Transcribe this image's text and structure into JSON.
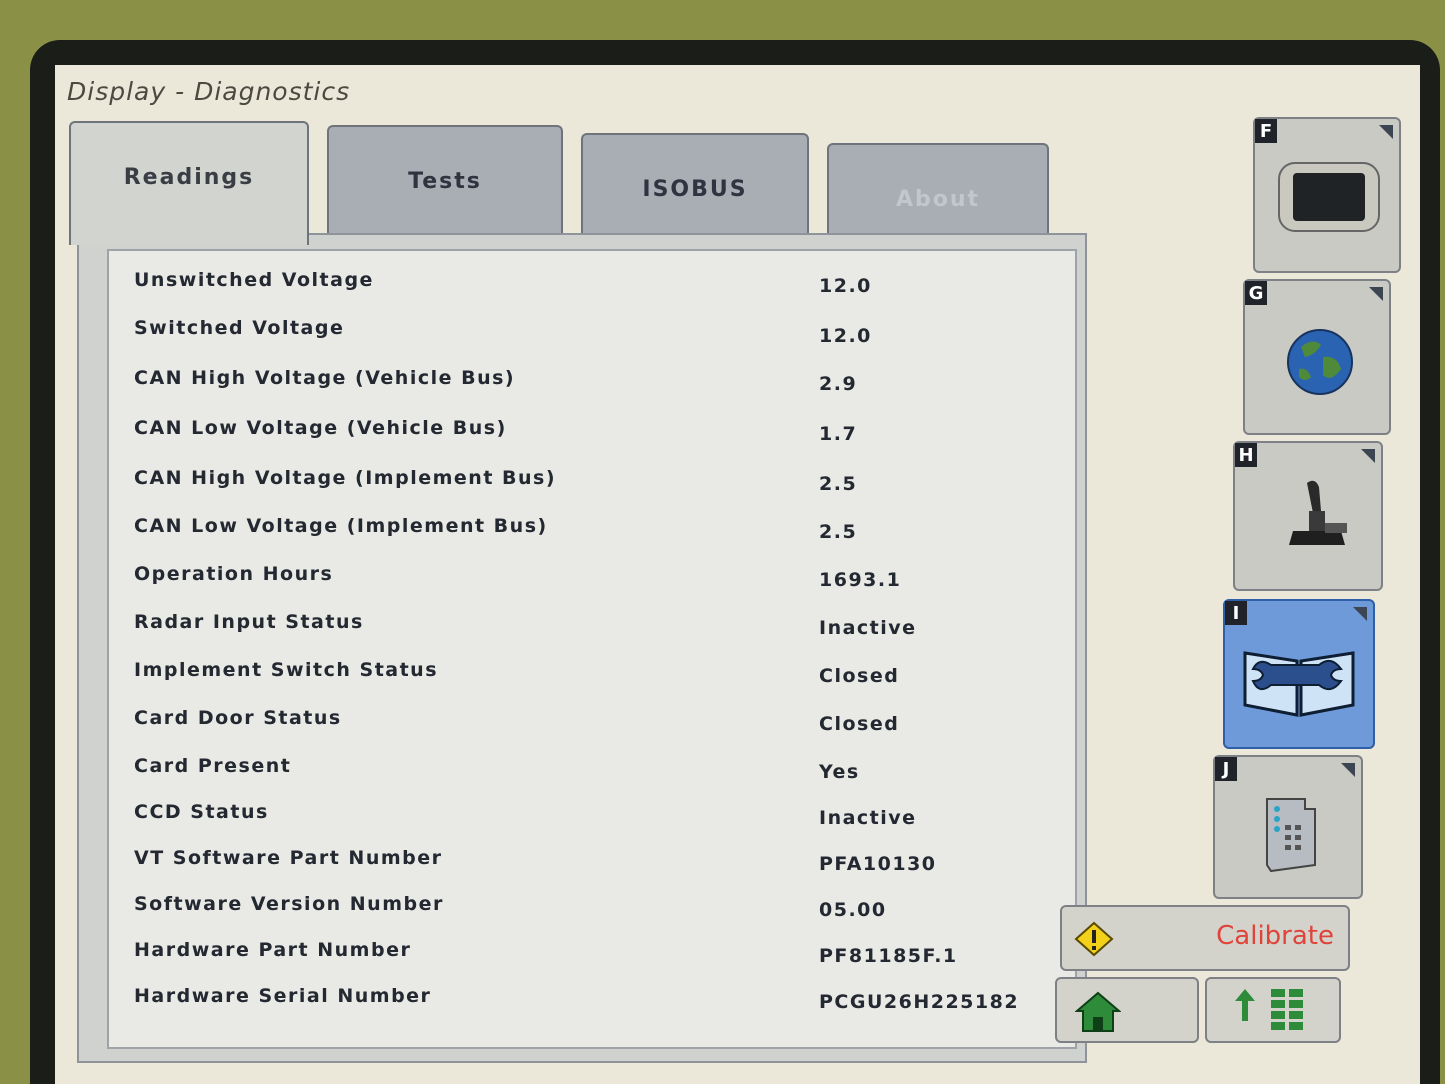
{
  "window": {
    "title": "Display - Diagnostics"
  },
  "tabs": [
    {
      "label": "Readings",
      "active": true
    },
    {
      "label": "Tests"
    },
    {
      "label": "ISOBUS"
    },
    {
      "label": "About",
      "disabled": true
    }
  ],
  "readings": [
    {
      "label": "Unswitched Voltage",
      "value": "12.0"
    },
    {
      "label": "Switched Voltage",
      "value": "12.0"
    },
    {
      "label": "CAN High Voltage (Vehicle Bus)",
      "value": "2.9"
    },
    {
      "label": "CAN Low Voltage (Vehicle Bus)",
      "value": "1.7"
    },
    {
      "label": "CAN High Voltage (Implement Bus)",
      "value": "2.5"
    },
    {
      "label": "CAN Low Voltage (Implement Bus)",
      "value": "2.5"
    },
    {
      "label": "Operation Hours",
      "value": "1693.1"
    },
    {
      "label": "Radar Input Status",
      "value": "Inactive"
    },
    {
      "label": "Implement Switch Status",
      "value": "Closed"
    },
    {
      "label": "Card Door Status",
      "value": "Closed"
    },
    {
      "label": "Card Present",
      "value": "Yes"
    },
    {
      "label": "CCD Status",
      "value": "Inactive"
    },
    {
      "label": "VT Software Part Number",
      "value": "PFA10130"
    },
    {
      "label": "Software Version Number",
      "value": "05.00"
    },
    {
      "label": "Hardware Part Number",
      "value": "PF81185F.1"
    },
    {
      "label": "Hardware Serial Number",
      "value": "PCGU26H225182"
    }
  ],
  "softkeys": [
    {
      "key": "F",
      "icon": "display-icon"
    },
    {
      "key": "G",
      "icon": "globe-icon"
    },
    {
      "key": "H",
      "icon": "joystick-icon"
    },
    {
      "key": "I",
      "icon": "service-manual-wrench-icon",
      "active": true
    },
    {
      "key": "J",
      "icon": "keypad-remote-icon"
    }
  ],
  "actions": {
    "calibrate_label": "Calibrate",
    "calibrate_icon": "warning-icon",
    "home_icon": "home-icon",
    "menu_icon": "up-arrow-menu-grid-icon"
  },
  "colors": {
    "active_softkey": "#6f9ad9",
    "calibrate_text": "#e0433a",
    "home_icon": "#2e8b3a"
  }
}
